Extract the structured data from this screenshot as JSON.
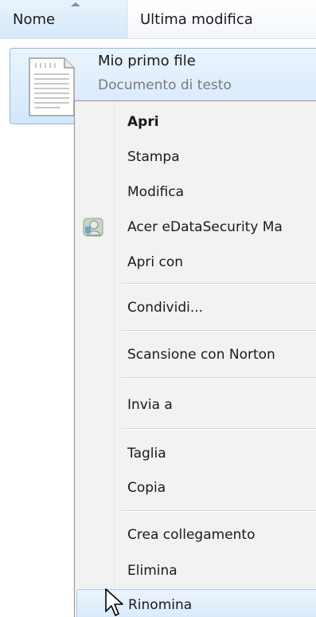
{
  "columns": {
    "name": "Nome",
    "modified": "Ultima modifica"
  },
  "file": {
    "name": "Mio primo file",
    "type": "Documento di testo",
    "icon": "text-document-icon"
  },
  "menu": {
    "items": [
      {
        "label": "Apri",
        "bold": true
      },
      {
        "label": "Stampa"
      },
      {
        "label": "Modifica"
      },
      {
        "label": "Acer eDataSecurity Ma",
        "icon": "edatasecurity-icon"
      },
      {
        "label": "Apri con"
      },
      {
        "label": "Condividi..."
      },
      {
        "label": "Scansione con Norton"
      },
      {
        "label": "Invia a"
      },
      {
        "label": "Taglia"
      },
      {
        "label": "Copia"
      },
      {
        "label": "Crea collegamento"
      },
      {
        "label": "Elimina"
      },
      {
        "label": "Rinomina",
        "highlighted": true
      }
    ]
  },
  "colors": {
    "selection": "#d3e7fb",
    "menu_background": "#f2f2f2",
    "menu_border": "#979797"
  }
}
